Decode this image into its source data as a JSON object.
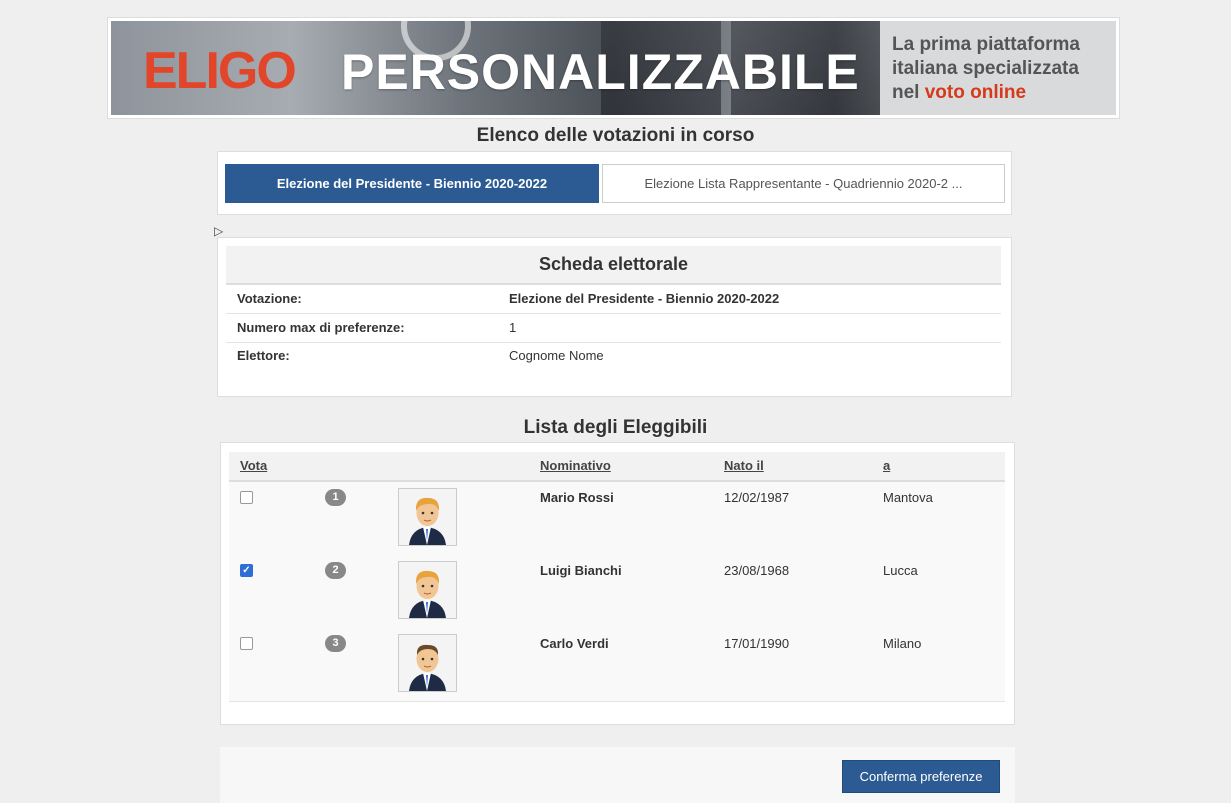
{
  "banner": {
    "logo": "ELIGO",
    "headline": "PERSONALIZZABILE",
    "tagline_1": "La prima piattaforma",
    "tagline_2": "italiana specializzata",
    "tagline_3_prefix": "nel ",
    "tagline_3_highlight": "voto online"
  },
  "votazioni": {
    "title": "Elenco delle votazioni in corso",
    "tabs": [
      {
        "label": "Elezione del Presidente - Biennio 2020-2022",
        "active": true
      },
      {
        "label": "Elezione Lista Rappresentante - Quadriennio 2020-2 ...",
        "active": false
      }
    ]
  },
  "scheda": {
    "title": "Scheda elettorale",
    "rows": [
      {
        "key": "Votazione:",
        "value": "Elezione del Presidente - Biennio 2020-2022"
      },
      {
        "key": "Numero max di preferenze:",
        "value": "1"
      },
      {
        "key": "Elettore:",
        "value": "Cognome Nome"
      }
    ]
  },
  "eleggibili": {
    "title": "Lista degli Eleggibili",
    "columns": {
      "vota": "Vota",
      "nominativo": "Nominativo",
      "nato_il": "Nato il",
      "a": "a"
    },
    "rows": [
      {
        "number": "1",
        "name": "Mario Rossi",
        "born": "12/02/1987",
        "city": "Mantova",
        "checked": false
      },
      {
        "number": "2",
        "name": "Luigi Bianchi",
        "born": "23/08/1968",
        "city": "Lucca",
        "checked": true
      },
      {
        "number": "3",
        "name": "Carlo Verdi",
        "born": "17/01/1990",
        "city": "Milano",
        "checked": false
      }
    ]
  },
  "footer": {
    "confirm_label": "Conferma preferenze"
  },
  "colors": {
    "primary": "#2c5b94",
    "brand_red": "#e2462a",
    "checkbox": "#2d6fd6"
  }
}
